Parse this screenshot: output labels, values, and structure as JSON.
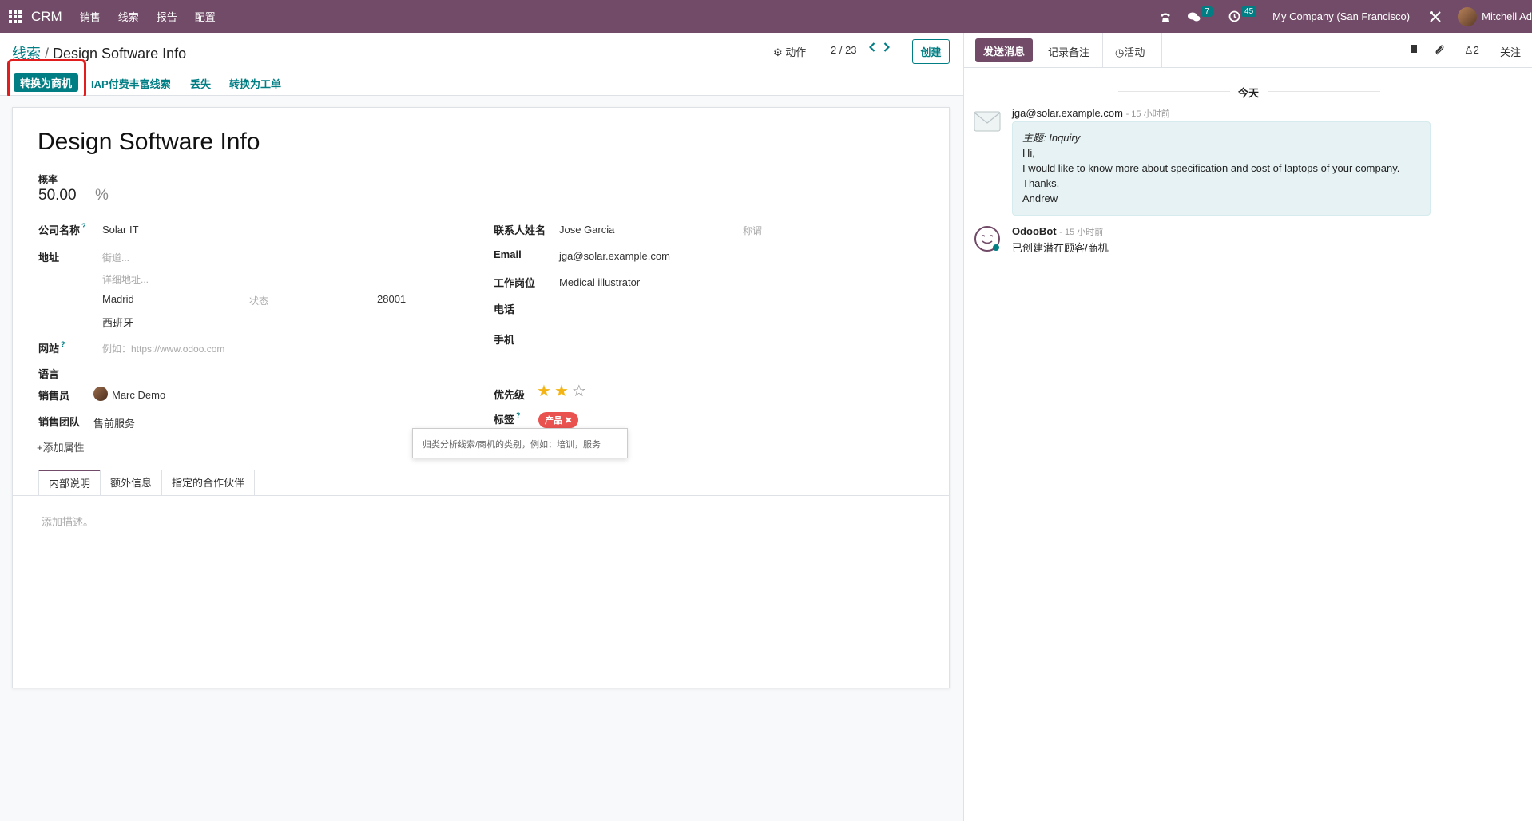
{
  "topnav": {
    "app_name": "CRM",
    "menu": [
      "销售",
      "线索",
      "报告",
      "配置"
    ],
    "messages_badge": "7",
    "activities_badge": "45",
    "company": "My Company (San Francisco)",
    "user": "Mitchell Ad"
  },
  "control": {
    "breadcrumb_parent": "线索",
    "breadcrumb_sep": "/",
    "breadcrumb_current": "Design Software Info",
    "actions_label": "动作",
    "pager": "2 / 23",
    "create_label": "创建"
  },
  "statusbar": {
    "convert_label": "转换为商机",
    "iap_label": "IAP付费丰富线索",
    "lost_label": "丢失",
    "ticket_label": "转换为工单"
  },
  "form": {
    "title": "Design Software Info",
    "probability_label": "概率",
    "probability_value": "50.00",
    "probability_unit": "%",
    "company_label": "公司名称",
    "company_value": "Solar IT",
    "address_label": "地址",
    "street_ph": "街道...",
    "street2_ph": "详细地址...",
    "city": "Madrid",
    "state_ph": "状态",
    "zip": "28001",
    "country": "西班牙",
    "website_label": "网站",
    "website_ph": "例如：https://www.odoo.com",
    "language_label": "语言",
    "salesperson_label": "销售员",
    "salesperson_value": "Marc Demo",
    "team_label": "销售团队",
    "team_value": "售前服务",
    "add_property": "添加属性",
    "contact_label": "联系人姓名",
    "contact_value": "Jose Garcia",
    "title_ph": "称谓",
    "email_label": "Email",
    "email_value": "jga@solar.example.com",
    "job_label": "工作岗位",
    "job_value": "Medical illustrator",
    "phone_label": "电话",
    "mobile_label": "手机",
    "priority_label": "优先级",
    "priority_value": 2,
    "priority_max": 3,
    "tags_label": "标签",
    "tag_value": "产品",
    "tooltip": "归类分析线索/商机的类别，例如：培训，服务",
    "tabs": [
      "内部说明",
      "额外信息",
      "指定的合作伙伴"
    ],
    "note_ph": "添加描述。"
  },
  "chatter": {
    "send_label": "发送消息",
    "note_label": "记录备注",
    "activity_label": "活动",
    "followers_count": "2",
    "follow_label": "关注",
    "today": "今天",
    "msg1_author": "jga@solar.example.com",
    "msg1_time": "- 15 小时前",
    "msg1_subject": "主题: Inquiry",
    "msg1_lines": [
      "Hi,",
      "I would like to know more about specification and cost of laptops of your company.",
      "Thanks,",
      "Andrew"
    ],
    "msg2_author": "OdooBot",
    "msg2_time": "- 15 小时前",
    "msg2_body": "已创建潜在顾客/商机"
  },
  "colors": {
    "brand": "#714B67",
    "accent": "#017e84",
    "highlight": "#e11d1d",
    "tag": "#e9524f",
    "star": "#f3b414"
  }
}
